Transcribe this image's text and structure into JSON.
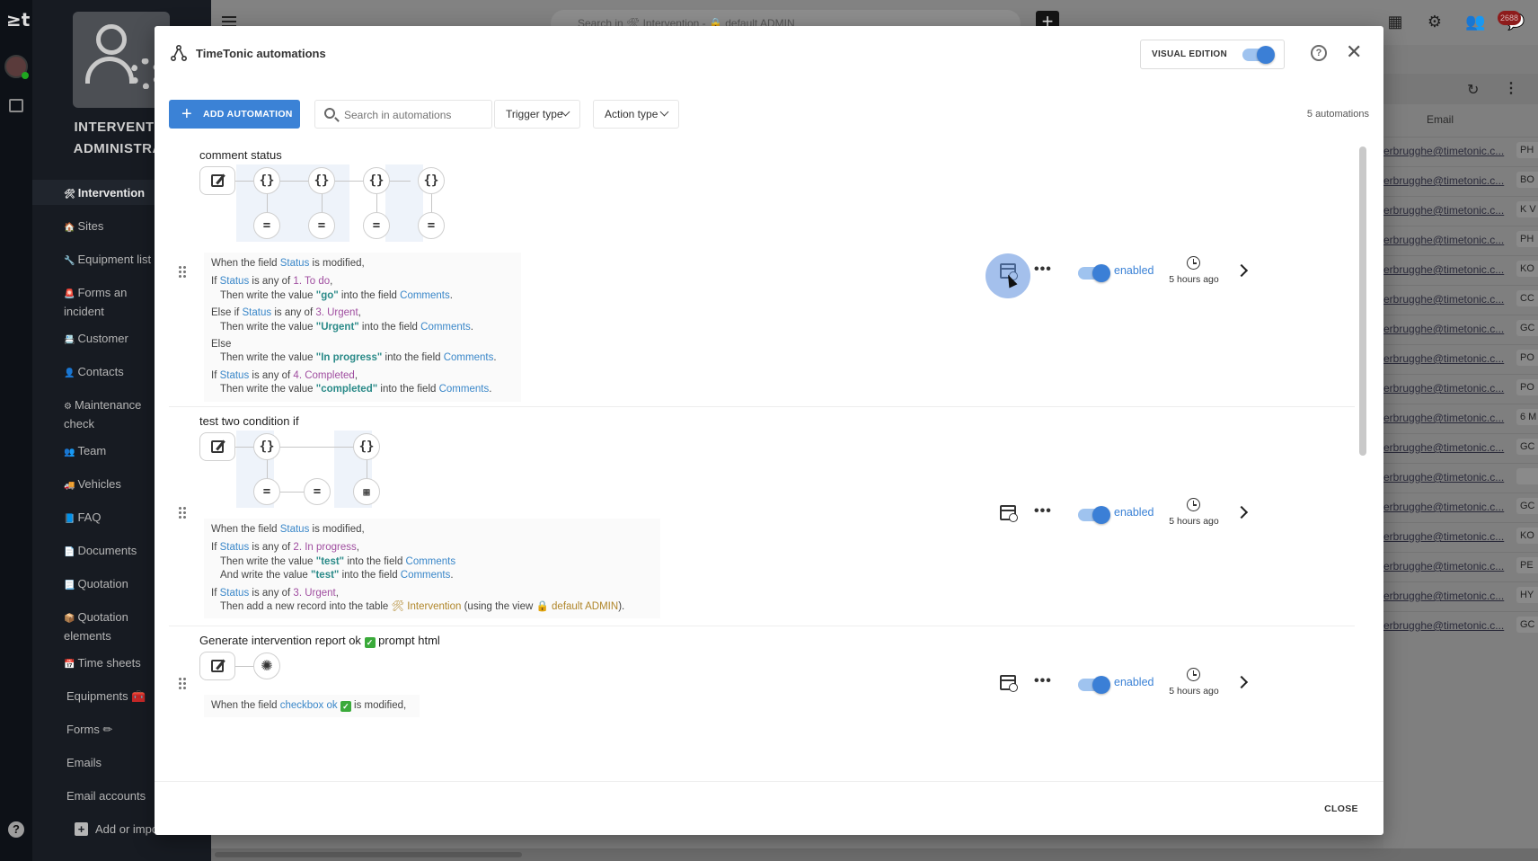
{
  "background_app": {
    "logo": "≥t",
    "workspace_name_line1": "INTERVENTIO",
    "workspace_name_line2": "ADMINISTRAT",
    "nav_items": [
      {
        "icon": "🛠",
        "label": "Intervention",
        "active": true
      },
      {
        "icon": "🏠",
        "label": "Sites"
      },
      {
        "icon": "🔧",
        "label": "Equipment list"
      },
      {
        "icon": "🚨",
        "label": "Forms an\nincident"
      },
      {
        "icon": "📇",
        "label": "Customer"
      },
      {
        "icon": "👤",
        "label": "Contacts"
      },
      {
        "icon": "⚙",
        "label": "Maintenance\ncheck"
      },
      {
        "icon": "👥",
        "label": "Team"
      },
      {
        "icon": "🚚",
        "label": "Vehicles"
      },
      {
        "icon": "📘",
        "label": "FAQ"
      },
      {
        "icon": "📄",
        "label": "Documents"
      },
      {
        "icon": "📃",
        "label": "Quotation"
      },
      {
        "icon": "📦",
        "label": "Quotation\nelements"
      },
      {
        "icon": "📅",
        "label": "Time sheets"
      },
      {
        "icon": "",
        "label": "Equipments 🧰"
      },
      {
        "icon": "",
        "label": "Forms ✏"
      },
      {
        "icon": "",
        "label": "Emails"
      },
      {
        "icon": "",
        "label": "Email accounts"
      }
    ],
    "add_import_label": "Add or impo",
    "search_placeholder": "Search in 🛠 Intervention - 🔒 default ADMIN",
    "notification_count": "2688",
    "table_header_email": "Email",
    "email_rows": [
      {
        "email": "erbrugghe@timetonic.c...",
        "code": "PH"
      },
      {
        "email": "erbrugghe@timetonic.c...",
        "code": "BO"
      },
      {
        "email": "erbrugghe@timetonic.c...",
        "code": "K V"
      },
      {
        "email": "erbrugghe@timetonic.c...",
        "code": "PH"
      },
      {
        "email": "erbrugghe@timetonic.c...",
        "code": "KO"
      },
      {
        "email": "erbrugghe@timetonic.c...",
        "code": "CC"
      },
      {
        "email": "erbrugghe@timetonic.c...",
        "code": "GC"
      },
      {
        "email": "erbrugghe@timetonic.c...",
        "code": "PO"
      },
      {
        "email": "erbrugghe@timetonic.c...",
        "code": "PO"
      },
      {
        "email": "erbrugghe@timetonic.c...",
        "code": "6 M"
      },
      {
        "email": "erbrugghe@timetonic.c...",
        "code": "GC"
      },
      {
        "email": "erbrugghe@timetonic.c...",
        "code": ""
      },
      {
        "email": "erbrugghe@timetonic.c...",
        "code": "GC"
      },
      {
        "email": "erbrugghe@timetonic.c...",
        "code": "KO"
      },
      {
        "email": "erbrugghe@timetonic.c...",
        "code": "PE"
      },
      {
        "email": "erbrugghe@timetonic.c...",
        "code": "HY"
      },
      {
        "email": "erbrugghe@timetonic.c...",
        "code": "GC"
      }
    ]
  },
  "modal": {
    "title": "TimeTonic automations",
    "visual_edition_label": "VISUAL EDITION",
    "visual_edition_on": true,
    "add_button_label": "ADD AUTOMATION",
    "search_placeholder": "Search in automations",
    "trigger_filter_label": "Trigger type",
    "action_filter_label": "Action type",
    "count_label": "5 automations",
    "close_label": "CLOSE",
    "automations": [
      {
        "title": "comment status",
        "status": "enabled",
        "time": "5 hours ago",
        "trigger": {
          "pre": "When the field ",
          "field": "Status",
          "post": " is modified,"
        },
        "branches": [
          {
            "kw": "If ",
            "field": "Status",
            "mid": " is any of ",
            "value": "1. To do",
            "end": ",",
            "then_pre": "Then write the value ",
            "then_val": "\"go\"",
            "then_mid": " into the field ",
            "then_field": "Comments",
            "then_end": "."
          },
          {
            "kw": "Else if ",
            "field": "Status",
            "mid": " is any of ",
            "value": "3. Urgent",
            "end": ",",
            "then_pre": "Then write the value ",
            "then_val": "\"Urgent\"",
            "then_mid": " into the field ",
            "then_field": "Comments",
            "then_end": "."
          },
          {
            "kw": "Else",
            "field": "",
            "mid": "",
            "value": "",
            "end": "",
            "then_pre": "Then write the value ",
            "then_val": "\"In progress\"",
            "then_mid": " into the field ",
            "then_field": "Comments",
            "then_end": "."
          },
          {
            "kw": "If ",
            "field": "Status",
            "mid": " is any of ",
            "value": "4. Completed",
            "end": ",",
            "then_pre": "Then write the value ",
            "then_val": "\"completed\"",
            "then_mid": " into the field ",
            "then_field": "Comments",
            "then_end": "."
          }
        ]
      },
      {
        "title": "test two condition if",
        "status": "enabled",
        "time": "5 hours ago",
        "trigger": {
          "pre": "When the field ",
          "field": "Status",
          "post": " is modified,"
        },
        "lines": {
          "b1_kw": "If ",
          "b1_field": "Status",
          "b1_mid": " is any of ",
          "b1_value": "2. In progress",
          "b1_end": ",",
          "b1_then_pre": "Then write the value ",
          "b1_then_val": "\"test\"",
          "b1_then_mid": " into the field ",
          "b1_then_field": "Comments",
          "b1_and_pre": "And write the value ",
          "b1_and_val": "\"test\"",
          "b1_and_mid": " into the field ",
          "b1_and_field": "Comments",
          "b1_and_end": ".",
          "b2_kw": "If ",
          "b2_field": "Status",
          "b2_mid": " is any of ",
          "b2_value": "3. Urgent",
          "b2_end": ",",
          "b2_then_pre": "Then add a new record into the table ",
          "b2_table": "🛠 Intervention",
          "b2_then_mid": " (using the view ",
          "b2_view": "🔒 default ADMIN",
          "b2_then_end": ")."
        }
      },
      {
        "title_pre": "Generate intervention report ok ",
        "title_check": "✓",
        "title_post": " prompt html",
        "status": "enabled",
        "time": "5 hours ago",
        "trigger": {
          "pre": "When the field ",
          "field": "checkbox ok ",
          "check": "✓",
          "post": " is modified,"
        }
      }
    ]
  },
  "colors": {
    "accent": "#3b82d6",
    "field": "#3a87c9",
    "value": "#a04ea0",
    "quoted": "#2a8a88",
    "table": "#b0862a"
  }
}
